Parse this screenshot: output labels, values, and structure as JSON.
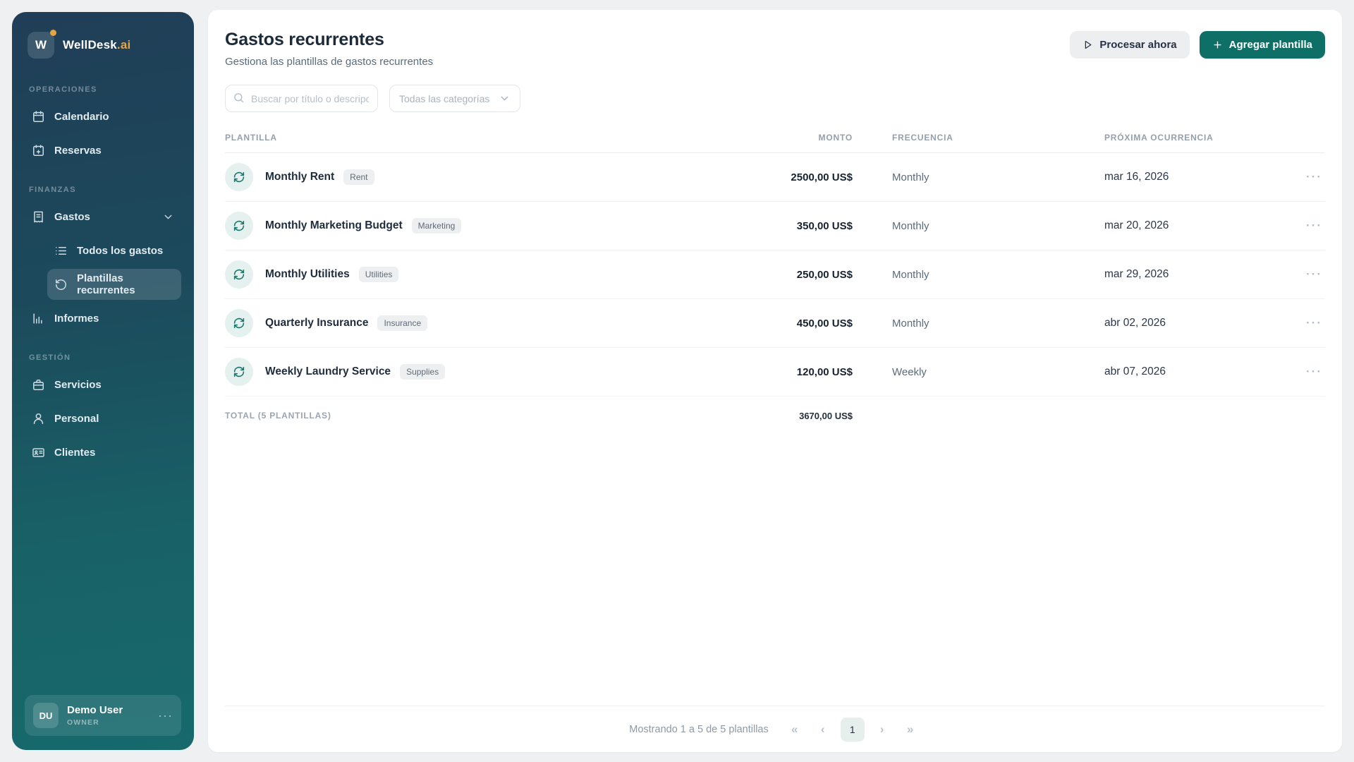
{
  "colors": {
    "accent_teal": "#0e6f67",
    "brand_gold": "#e3a44e",
    "sidebar_top": "#203e57",
    "sidebar_bottom": "#17696c",
    "row_icon_bg": "#e4f1ee"
  },
  "brand": {
    "initial": "W",
    "name": "WellDesk",
    "suffix": ".ai"
  },
  "sidebar": {
    "sections": [
      {
        "label": "OPERACIONES",
        "items": [
          {
            "label": "Calendario"
          },
          {
            "label": "Reservas"
          }
        ]
      },
      {
        "label": "FINANZAS",
        "items": [
          {
            "label": "Gastos"
          },
          {
            "label": "Todos los gastos"
          },
          {
            "label": "Plantillas recurrentes"
          },
          {
            "label": "Informes"
          }
        ]
      },
      {
        "label": "GESTIÓN",
        "items": [
          {
            "label": "Servicios"
          },
          {
            "label": "Personal"
          },
          {
            "label": "Clientes"
          }
        ]
      }
    ],
    "user": {
      "initials": "DU",
      "name": "Demo User",
      "role": "OWNER",
      "menu_glyph": "···"
    }
  },
  "header": {
    "title": "Gastos recurrentes",
    "subtitle": "Gestiona las plantillas de gastos recurrentes",
    "process_button": "Procesar ahora",
    "add_button": "Agregar plantilla"
  },
  "filters": {
    "search_placeholder": "Buscar por título o descripci",
    "category_selected": "Todas las categorías"
  },
  "table": {
    "columns": {
      "plantilla": "PLANTILLA",
      "monto": "MONTO",
      "frecuencia": "FRECUENCIA",
      "proxima": "PRÓXIMA OCURRENCIA"
    },
    "rows": [
      {
        "name": "Monthly Rent",
        "tag": "Rent",
        "amount": "2500,00 US$",
        "frequency": "Monthly",
        "next_occurrence": "mar 16, 2026",
        "actions_glyph": "···"
      },
      {
        "name": "Monthly Marketing Budget",
        "tag": "Marketing",
        "amount": "350,00 US$",
        "frequency": "Monthly",
        "next_occurrence": "mar 20, 2026",
        "actions_glyph": "···"
      },
      {
        "name": "Monthly Utilities",
        "tag": "Utilities",
        "amount": "250,00 US$",
        "frequency": "Monthly",
        "next_occurrence": "mar 29, 2026",
        "actions_glyph": "···"
      },
      {
        "name": "Quarterly Insurance",
        "tag": "Insurance",
        "amount": "450,00 US$",
        "frequency": "Monthly",
        "next_occurrence": "abr 02, 2026",
        "actions_glyph": "···"
      },
      {
        "name": "Weekly Laundry Service",
        "tag": "Supplies",
        "amount": "120,00 US$",
        "frequency": "Weekly",
        "next_occurrence": "abr 07, 2026",
        "actions_glyph": "···"
      }
    ],
    "total_label": "TOTAL (5 PLANTILLAS)",
    "total_amount": "3670,00 US$"
  },
  "pagination": {
    "summary": "Mostrando 1 a 5 de 5 plantillas",
    "first_glyph": "«",
    "prev_glyph": "‹",
    "page": "1",
    "next_glyph": "›",
    "last_glyph": "»"
  }
}
